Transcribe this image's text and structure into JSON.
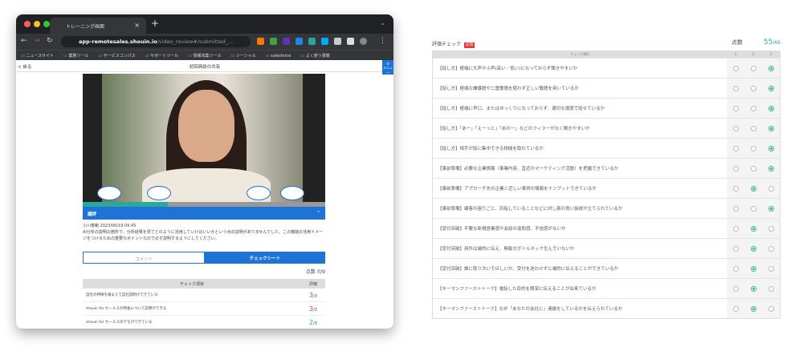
{
  "browser": {
    "tab_title": "トレーニング画面",
    "url_host": "app-remotesales.shouin.io",
    "url_path": "/video_review#/submitted_...",
    "bookmarks": [
      "ニュースサイト",
      "業務ツール",
      "サービスコンパス",
      "サポートツール",
      "情報収集ツール",
      "ソーシャル",
      "salesforce",
      "よく使う書籍"
    ]
  },
  "page": {
    "back": "< 戻る",
    "title": "初回商談の共有",
    "menu": "メニュー",
    "review_header": "講評",
    "review_toggle": "^",
    "comment_meta": "小川泰範 2023/06/19 09:45",
    "comment_text": "AI分析の説明の箇所で、分析結果を見てどのように活用していけばいいかという点の説明がありませんでした。この機能の活用イメージをつけるための重要なポイントなので必ず説明するようにしてください。",
    "tab_comment": "コメント",
    "tab_checksheet": "チェックシート",
    "score_label": "点数",
    "score_value": "8",
    "score_total": "/9",
    "table_header_item": "チェック項目",
    "table_header_rating": "評価",
    "rows": [
      {
        "item": "自社の特徴を踏まえて自社説明ができている",
        "score": "3",
        "max": "/3",
        "color": "#d6336c"
      },
      {
        "item": "shouin for セールスの特長について説明ができる",
        "score": "3",
        "max": "/3",
        "color": "#d6336c"
      },
      {
        "item": "shouin for セールスのデモができている",
        "score": "2",
        "max": "/3",
        "color": "#2ba89a"
      }
    ],
    "video_progress": 0.35
  },
  "panel": {
    "title": "評価チェック",
    "required_badge": "必須",
    "score_label": "点数",
    "score_value": "55",
    "score_total": "/66",
    "header_item": "チェック項目",
    "scale": [
      "1",
      "2",
      "3"
    ],
    "rows": [
      {
        "q": "【話し方】極端に大声や小声(高い／低い)になっておらず聞きやすいか",
        "sel": 3
      },
      {
        "q": "【話し方】極端な謙譲語や二重敬語を使わず正しい敬語を用いているか",
        "sel": 3
      },
      {
        "q": "【話し方】極端に早口、またはゆっくりになっておらず、適切な速度で話せているか",
        "sel": 3
      },
      {
        "q": "【話し方】「あー」「えーっと」「あのー」などのフィラーがなく聞きやすいか",
        "sel": 3
      },
      {
        "q": "【話し方】相手が話に集中できる相槌を取れているか",
        "sel": 3
      },
      {
        "q": "【事前準備】必要な企業情報（事業内容、直近のマーケティング活動）を把握できているか",
        "sel": 3
      },
      {
        "q": "【事前準備】アプローチ先の企業と近しい事例の情報をインプットできているか",
        "sel": 2
      },
      {
        "q": "【事前準備】顧客の困りごと、目指していることなどに対し筋の良い仮説が立てられているか",
        "sel": 3
      },
      {
        "q": "【受付突破】不要な新規営業感や会話の違和感、不信感がないか",
        "sel": 2
      },
      {
        "q": "【受付突破】用件は端的に伝え、無駄なボトルネック生んでいないか",
        "sel": 2
      },
      {
        "q": "【受付突破】誰に取り次いでほしいか、受付を迷わせずに端的に伝えることができているか",
        "sel": 2
      },
      {
        "q": "【キーマンファーストトーク】電話した目的を簡潔に伝えることが出来ているか",
        "sel": 2
      },
      {
        "q": "【キーマンファーストトーク】なぜ「あなたの会社に」連絡をしているかを伝えられているか",
        "sel": 2
      }
    ]
  }
}
